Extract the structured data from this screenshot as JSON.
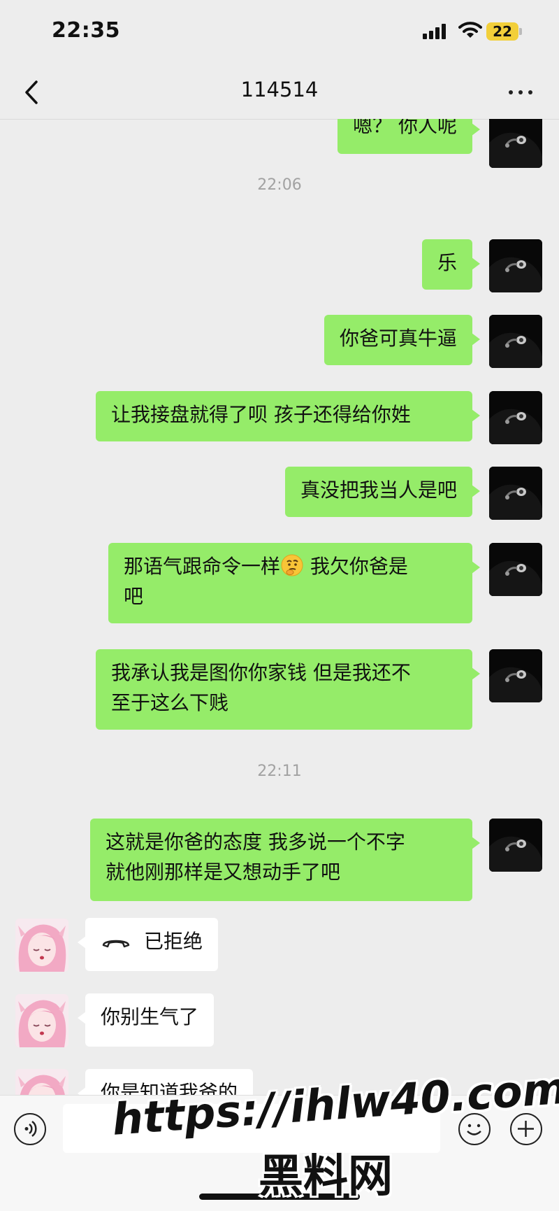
{
  "status_bar": {
    "time": "22:35",
    "battery": "22"
  },
  "header": {
    "title": "114514"
  },
  "messages": {
    "m0": "嗯？ 你人呢",
    "ts1": "22:06",
    "m1": "乐",
    "m2": "你爸可真牛逼",
    "m3": "让我接盘就得了呗 孩子还得给你姓",
    "m4": "真没把我当人是吧",
    "m5a": "那语气跟命令一样",
    "m5b": " 我欠你爸是",
    "m5c": "吧",
    "m6a": "我承认我是图你你家钱 但是我还不",
    "m6b": "至于这么下贱",
    "ts2": "22:11",
    "m7a": "这就是你爸的态度 我多说一个不字",
    "m7b": "就他刚那样是又想动手了吧",
    "call_status": "已拒绝",
    "h2": "你别生气了",
    "h3": "你是知道我爸的"
  },
  "watermark": {
    "url": "https://ihlw40.com",
    "site": "黑料网"
  },
  "colors": {
    "outgoing_bubble": "#95ec69",
    "incoming_bubble": "#ffffff",
    "background": "#ededed"
  }
}
